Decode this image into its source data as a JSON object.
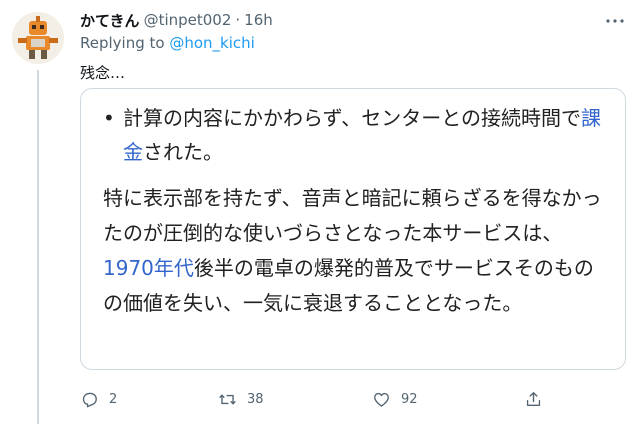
{
  "tweet": {
    "display_name": "かてきん",
    "handle": "@tinpet002",
    "separator": "·",
    "time": "16h",
    "reply_prefix": "Replying to ",
    "reply_to": "@hon_kichi",
    "text": "残念…"
  },
  "quote": {
    "bullet": "•",
    "bullet_text_1": "計算の内容にかかわらず、センターとの接続時間で",
    "bullet_link": "課金",
    "bullet_text_2": "された。",
    "para_1": "特に表示部を持たず、音声と暗記に頼らざるを得なかったのが圧倒的な使いづらさとなった本サービスは、",
    "para_link": "1970年代",
    "para_2": "後半の電卓の爆発的普及でサービスそのものの価値を失い、一気に衰退することとなった。"
  },
  "actions": {
    "reply_count": "2",
    "retweet_count": "38",
    "like_count": "92"
  },
  "colors": {
    "text": "#0f1419",
    "secondary": "#536471",
    "accent": "#1d9bf0",
    "wiki_link": "#3366cc",
    "border": "#cfd9de"
  },
  "icons": {
    "more": "more-icon",
    "reply": "reply-icon",
    "retweet": "retweet-icon",
    "like": "heart-icon",
    "share": "share-icon"
  }
}
